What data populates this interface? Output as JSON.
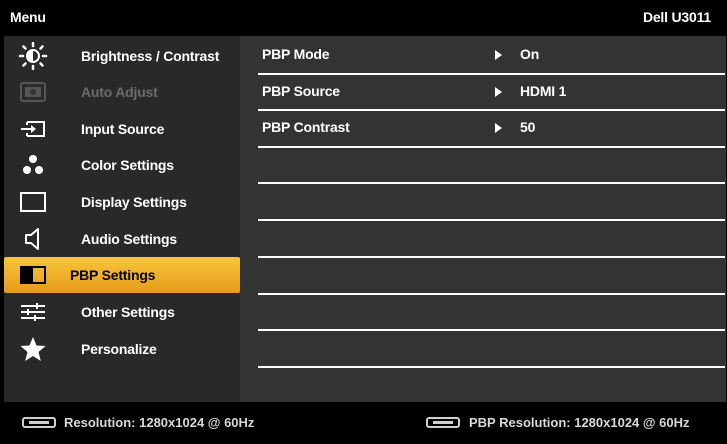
{
  "header": {
    "title": "Menu",
    "model": "Dell U3011"
  },
  "sidebar": {
    "items": [
      {
        "label": "Brightness / Contrast",
        "icon": "brightness-icon",
        "state": "normal"
      },
      {
        "label": "Auto Adjust",
        "icon": "auto-adjust-icon",
        "state": "disabled"
      },
      {
        "label": "Input Source",
        "icon": "input-source-icon",
        "state": "normal"
      },
      {
        "label": "Color Settings",
        "icon": "color-settings-icon",
        "state": "normal"
      },
      {
        "label": "Display Settings",
        "icon": "display-settings-icon",
        "state": "normal"
      },
      {
        "label": "Audio Settings",
        "icon": "speaker-icon",
        "state": "normal"
      },
      {
        "label": "PBP Settings",
        "icon": "pbp-icon",
        "state": "selected"
      },
      {
        "label": "Other Settings",
        "icon": "sliders-icon",
        "state": "normal"
      },
      {
        "label": "Personalize",
        "icon": "star-icon",
        "state": "normal"
      }
    ]
  },
  "settings": {
    "rows": [
      {
        "label": "PBP Mode",
        "value": "On"
      },
      {
        "label": "PBP Source",
        "value": "HDMI 1"
      },
      {
        "label": "PBP Contrast",
        "value": "50"
      }
    ]
  },
  "footer": {
    "resolution": "Resolution: 1280x1024 @ 60Hz",
    "pbp_resolution": "PBP Resolution: 1280x1024 @ 60Hz"
  },
  "colors": {
    "selected_top": "#f6c63a",
    "selected_bottom": "#e79b1c",
    "left_panel": "#292929",
    "right_panel": "#333333"
  }
}
